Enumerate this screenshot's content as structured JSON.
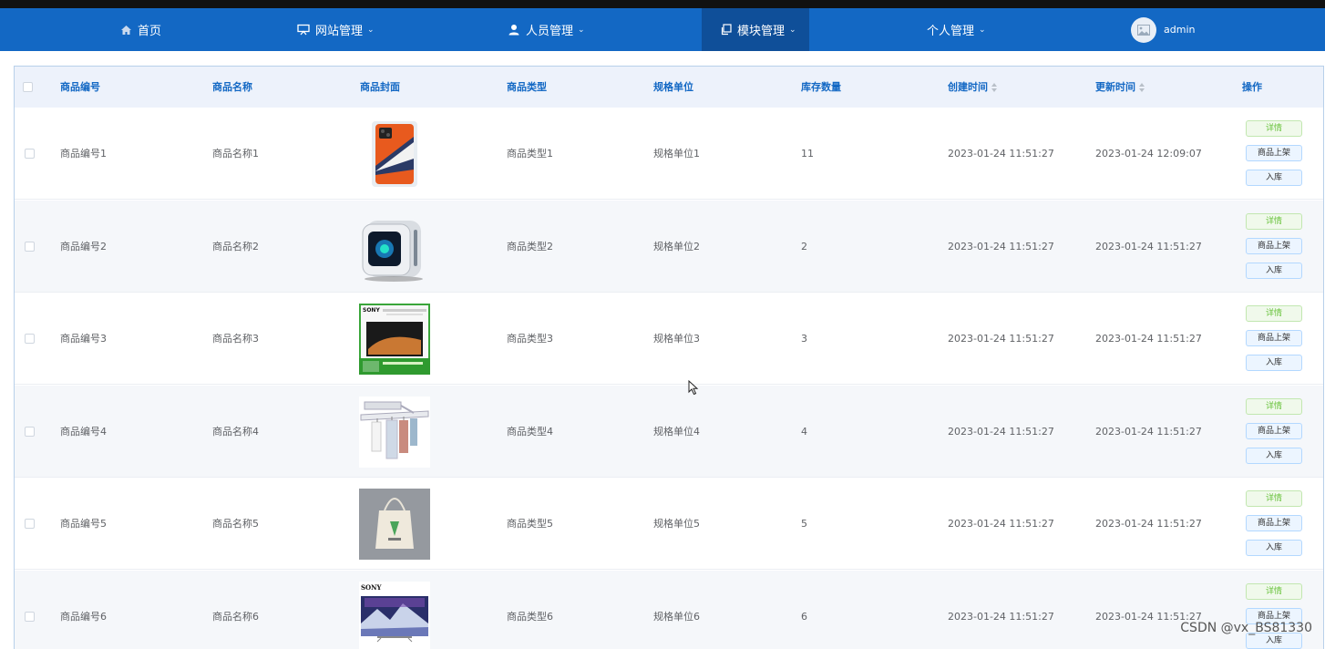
{
  "nav": {
    "home": "首页",
    "website": "网站管理",
    "people": "人员管理",
    "modules": "模块管理",
    "personal": "个人管理",
    "user": "admin"
  },
  "table": {
    "headers": {
      "id": "商品编号",
      "name": "商品名称",
      "cover": "商品封面",
      "type": "商品类型",
      "unit": "规格单位",
      "stock": "库存数量",
      "created": "创建时间",
      "updated": "更新时间",
      "ops": "操作"
    },
    "buttons": {
      "detail": "详情",
      "onshelf": "商品上架",
      "stockin": "入库"
    },
    "rows": [
      {
        "id": "商品编号1",
        "name": "商品名称1",
        "cover": "phone",
        "type": "商品类型1",
        "unit": "规格单位1",
        "stock": "11",
        "created": "2023-01-24 11:51:27",
        "updated": "2023-01-24 12:09:07"
      },
      {
        "id": "商品编号2",
        "name": "商品名称2",
        "cover": "pc",
        "type": "商品类型2",
        "unit": "规格单位2",
        "stock": "2",
        "created": "2023-01-24 11:51:27",
        "updated": "2023-01-24 11:51:27"
      },
      {
        "id": "商品编号3",
        "name": "商品名称3",
        "cover": "tv",
        "type": "商品类型3",
        "unit": "规格单位3",
        "stock": "3",
        "created": "2023-01-24 11:51:27",
        "updated": "2023-01-24 11:51:27"
      },
      {
        "id": "商品编号4",
        "name": "商品名称4",
        "cover": "rack",
        "type": "商品类型4",
        "unit": "规格单位4",
        "stock": "4",
        "created": "2023-01-24 11:51:27",
        "updated": "2023-01-24 11:51:27"
      },
      {
        "id": "商品编号5",
        "name": "商品名称5",
        "cover": "bag",
        "type": "商品类型5",
        "unit": "规格单位5",
        "stock": "5",
        "created": "2023-01-24 11:51:27",
        "updated": "2023-01-24 11:51:27"
      },
      {
        "id": "商品编号6",
        "name": "商品名称6",
        "cover": "tv2",
        "type": "商品类型6",
        "unit": "规格单位6",
        "stock": "6",
        "created": "2023-01-24 11:51:27",
        "updated": "2023-01-24 11:51:27"
      }
    ]
  },
  "watermark": "CSDN @vx_BS81330"
}
